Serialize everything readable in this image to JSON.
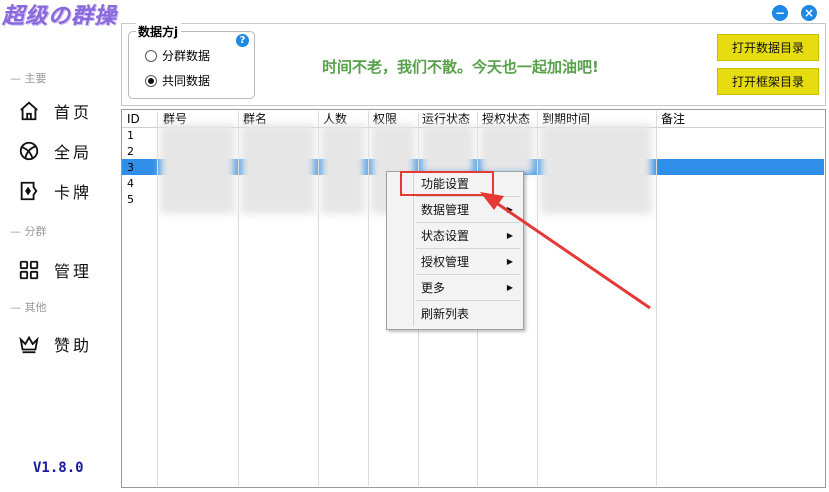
{
  "app": {
    "logo": "超级の群操",
    "version": "V1.8.0"
  },
  "sidebar": {
    "section_main": "— 主要",
    "section_group": "— 分群",
    "section_other": "— 其他",
    "items": [
      {
        "label": "首页",
        "icon": "home-icon"
      },
      {
        "label": "全局",
        "icon": "globe-icon"
      },
      {
        "label": "卡牌",
        "icon": "card-icon"
      },
      {
        "label": "管理",
        "icon": "grid-icon"
      },
      {
        "label": "赞助",
        "icon": "crown-icon"
      }
    ]
  },
  "window": {
    "minimize": "−",
    "close": "×"
  },
  "data_panel": {
    "title": "数据方j",
    "help": "?",
    "options": [
      "分群数据",
      "共同数据"
    ],
    "selected": "共同数据"
  },
  "slogan": "时间不老，我们不散。今天也一起加油吧!",
  "buttons": {
    "open_data_dir": "打开数据目录",
    "open_frame_dir": "打开框架目录"
  },
  "table": {
    "columns": [
      "ID",
      "群号",
      "群名",
      "人数",
      "权限",
      "运行状态",
      "授权状态",
      "到期时间",
      "备注"
    ],
    "rows": [
      {
        "id": "1"
      },
      {
        "id": "2"
      },
      {
        "id": "3"
      },
      {
        "id": "4"
      },
      {
        "id": "5"
      }
    ],
    "selected_row_id": "3"
  },
  "context_menu": {
    "items": [
      {
        "label": "功能设置",
        "submenu": false
      },
      {
        "label": "数据管理",
        "submenu": true
      },
      {
        "label": "状态设置",
        "submenu": true
      },
      {
        "label": "授权管理",
        "submenu": true
      },
      {
        "label": "更多",
        "submenu": true
      },
      {
        "label": "刷新列表",
        "submenu": false
      }
    ],
    "highlighted": "功能设置"
  },
  "colors": {
    "accent": "#1e88e5",
    "selection": "#2f8fe8",
    "slogan": "#58a04a",
    "button": "#e6dc10",
    "annotation": "#e53935"
  }
}
